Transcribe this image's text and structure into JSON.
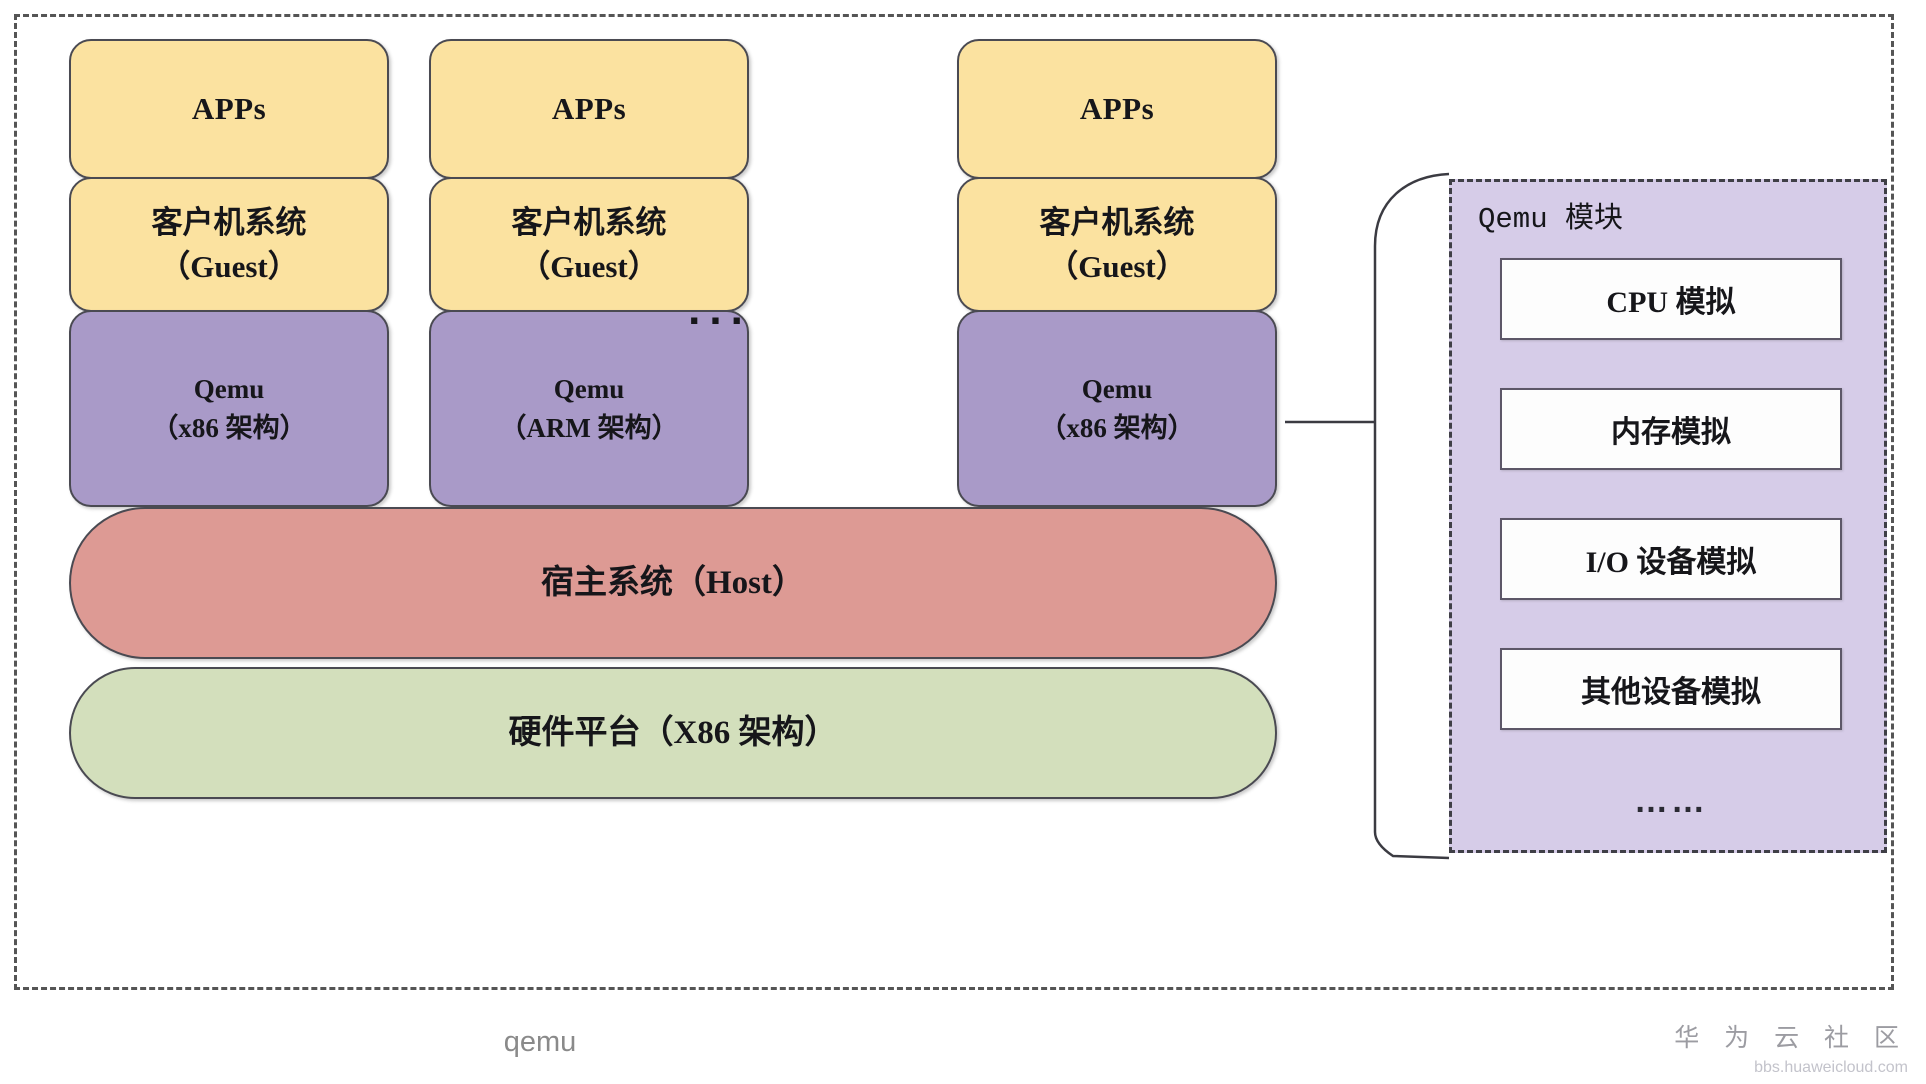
{
  "diagram": {
    "caption": "qemu",
    "vm_ellipsis": "...",
    "columns": [
      {
        "apps": "APPs",
        "guest_line1": "客户机系统",
        "guest_line2": "（Guest）",
        "qemu_line1": "Qemu",
        "qemu_line2": "（x86 架构）"
      },
      {
        "apps": "APPs",
        "guest_line1": "客户机系统",
        "guest_line2": "（Guest）",
        "qemu_line1": "Qemu",
        "qemu_line2": "（ARM 架构）"
      },
      {
        "apps": "APPs",
        "guest_line1": "客户机系统",
        "guest_line2": "（Guest）",
        "qemu_line1": "Qemu",
        "qemu_line2": "（x86 架构）"
      }
    ],
    "host_band": "宿主系统（Host）",
    "hardware_band": "硬件平台（X86 架构）",
    "qemu_module": {
      "title": "Qemu 模块",
      "items": [
        "CPU 模拟",
        "内存模拟",
        "I/O 设备模拟",
        "其他设备模拟"
      ],
      "ellipsis": "……"
    },
    "watermark": {
      "brand": "华 为 云 社 区",
      "url": "bbs.huaweicloud.com"
    },
    "colors": {
      "apps_fill": "#fbe2a0",
      "guest_fill": "#fbe2a0",
      "qemu_fill": "#a99ac8",
      "host_fill": "#dd9a94",
      "hardware_fill": "#d3dfbc",
      "module_panel_fill": "#d6cce8",
      "module_item_fill": "#fdfdfd",
      "outline": "#4a4a52",
      "frame_dash": "#555555"
    }
  }
}
